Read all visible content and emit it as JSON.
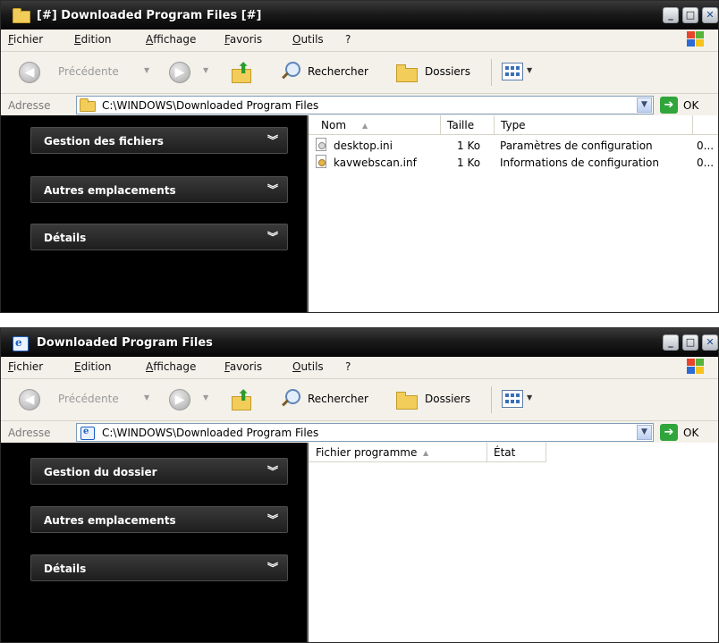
{
  "windows": [
    {
      "title": "[#] Downloaded Program Files [#]",
      "menu": [
        "Fichier",
        "Edition",
        "Affichage",
        "Favoris",
        "Outils",
        "?"
      ],
      "toolbar": {
        "back": "Précédente",
        "search": "Rechercher",
        "folders": "Dossiers"
      },
      "address": {
        "label": "Adresse",
        "value": "C:\\WINDOWS\\Downloaded Program Files",
        "go": "OK"
      },
      "taskpane": [
        "Gestion des fichiers",
        "Autres emplacements",
        "Détails"
      ],
      "columns": [
        "Nom",
        "Taille",
        "Type"
      ],
      "files": [
        {
          "name": "desktop.ini",
          "size": "1 Ko",
          "type": "Paramètres de configuration",
          "extra": "0..."
        },
        {
          "name": "kavwebscan.inf",
          "size": "1 Ko",
          "type": "Informations de configuration",
          "extra": "0..."
        }
      ]
    },
    {
      "title": "Downloaded Program Files",
      "menu": [
        "Fichier",
        "Edition",
        "Affichage",
        "Favoris",
        "Outils",
        "?"
      ],
      "toolbar": {
        "back": "Précédente",
        "search": "Rechercher",
        "folders": "Dossiers"
      },
      "address": {
        "label": "Adresse",
        "value": "C:\\WINDOWS\\Downloaded Program Files",
        "go": "OK"
      },
      "taskpane": [
        "Gestion du dossier",
        "Autres emplacements",
        "Détails"
      ],
      "columns": [
        "Fichier programme",
        "État"
      ]
    }
  ],
  "colors": {
    "title_gradient_top": "#3a3a3a",
    "title_gradient_bottom": "#060606",
    "go_button": "#2fa53b",
    "taskpane_bg": "#000000"
  }
}
